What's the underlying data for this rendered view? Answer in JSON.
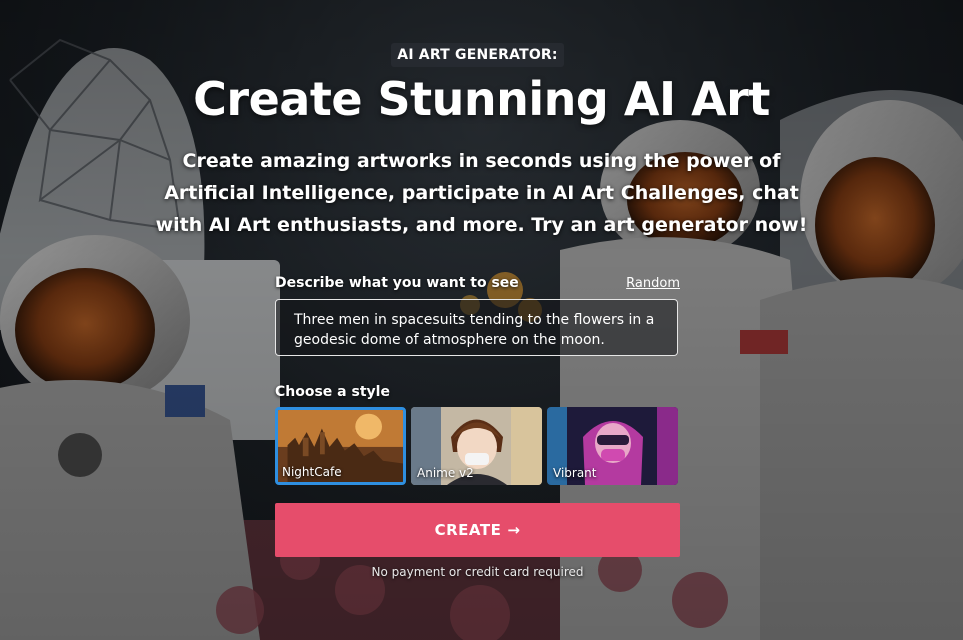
{
  "hero": {
    "eyebrow": "AI ART GENERATOR:",
    "title": "Create Stunning AI Art",
    "subtitle": "Create amazing artworks in seconds using the power of Artificial Intelligence, participate in AI Art Challenges, chat with AI Art enthusiasts, and more. Try an art generator now!",
    "background_icon": "astronauts-moon-image"
  },
  "form": {
    "prompt_label": "Describe what you want to see",
    "random_label": "Random",
    "prompt_value": "Three men in spacesuits tending to the flowers in a geodesic dome of atmosphere on the moon.",
    "style_label": "Choose a style",
    "styles": [
      {
        "name": "NightCafe",
        "selected": true,
        "icon": "castle-thumbnail"
      },
      {
        "name": "Anime v2",
        "selected": false,
        "icon": "anime-character-thumbnail"
      },
      {
        "name": "Vibrant",
        "selected": false,
        "icon": "neon-character-thumbnail"
      }
    ],
    "create_label": "CREATE",
    "create_icon": "arrow-right-icon",
    "note": "No payment or credit card required"
  },
  "colors": {
    "accent": "#e64d6b",
    "selected_border": "#2f8fe0"
  }
}
